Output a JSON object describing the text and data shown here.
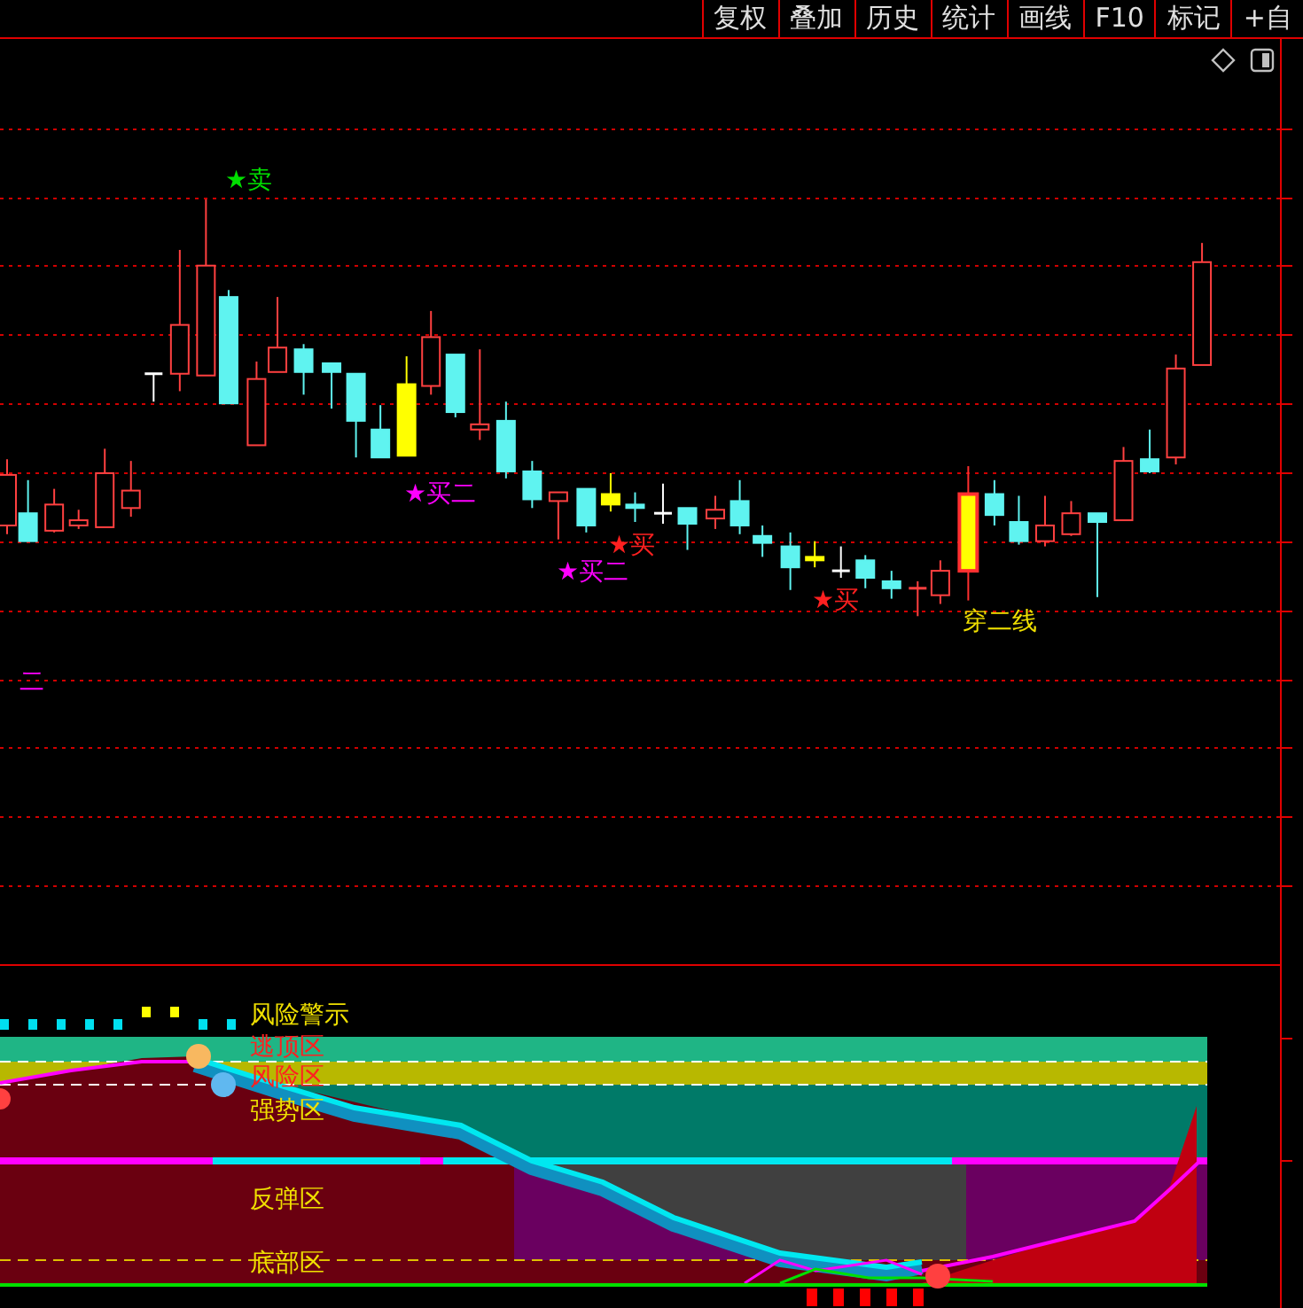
{
  "toolbar": {
    "buttons": [
      {
        "label": "复权"
      },
      {
        "label": "叠加"
      },
      {
        "label": "历史"
      },
      {
        "label": "统计"
      },
      {
        "label": "画线"
      },
      {
        "label": "F10"
      },
      {
        "label": "标记"
      },
      {
        "label": "+自"
      }
    ]
  },
  "price_chart": {
    "annotations": [
      {
        "text": "★卖",
        "kind": "sell"
      },
      {
        "text": "★买二",
        "kind": "buy2"
      },
      {
        "text": "★买",
        "kind": "buy"
      },
      {
        "text": "★买二",
        "kind": "buy2"
      },
      {
        "text": "★买",
        "kind": "buy"
      },
      {
        "text": "穿二线",
        "kind": "cross"
      },
      {
        "text": "二",
        "kind": "buy2"
      }
    ]
  },
  "indicator_panel": {
    "zones": [
      {
        "label": "风险警示",
        "kind": "notice"
      },
      {
        "label": "逃顶区",
        "kind": "danger"
      },
      {
        "label": "风险区",
        "kind": "danger"
      },
      {
        "label": "强势区",
        "kind": "notice"
      },
      {
        "label": "反弹区",
        "kind": "notice"
      },
      {
        "label": "底部区",
        "kind": "notice"
      }
    ]
  }
}
